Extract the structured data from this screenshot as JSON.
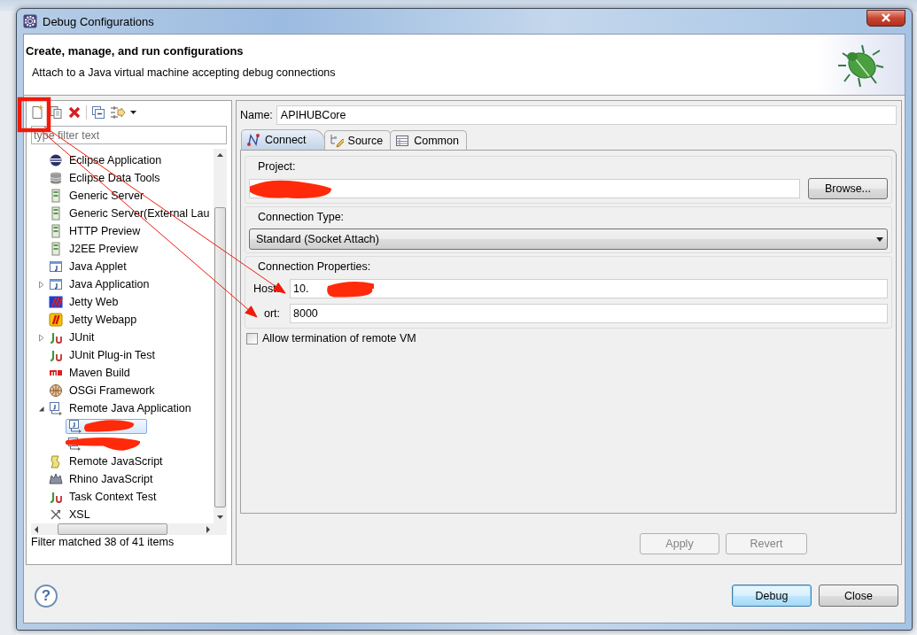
{
  "window": {
    "title": "Debug Configurations"
  },
  "header": {
    "title": "Create, manage, and run configurations",
    "message": "Attach to a Java virtual machine accepting debug connections"
  },
  "filter": {
    "placeholder": "type filter text"
  },
  "tree": [
    {
      "label": "Eclipse Application"
    },
    {
      "label": "Eclipse Data Tools"
    },
    {
      "label": "Generic Server"
    },
    {
      "label": "Generic Server(External Lau"
    },
    {
      "label": "HTTP Preview"
    },
    {
      "label": "J2EE Preview"
    },
    {
      "label": "Java Applet"
    },
    {
      "label": "Java Application",
      "expanded": false
    },
    {
      "label": "Jetty Web"
    },
    {
      "label": "Jetty Webapp"
    },
    {
      "label": "JUnit",
      "expanded": false
    },
    {
      "label": "JUnit Plug-in Test"
    },
    {
      "label": "Maven Build"
    },
    {
      "label": "OSGi Framework"
    },
    {
      "label": "Remote Java Application",
      "expanded": true,
      "children": [
        {
          "selected": true
        },
        {
          "selected": false
        }
      ]
    },
    {
      "label": "Remote JavaScript"
    },
    {
      "label": "Rhino JavaScript"
    },
    {
      "label": "Task Context Test"
    },
    {
      "label": "XSL"
    }
  ],
  "filter_status": "Filter matched 38 of 41 items",
  "name": {
    "label": "Name:",
    "value": "APIHUBCore"
  },
  "tabs": [
    {
      "label": "Connect",
      "selected": true
    },
    {
      "label": "Source",
      "selected": false
    },
    {
      "label": "Common",
      "selected": false
    }
  ],
  "project": {
    "label": "Project:",
    "browse": "Browse..."
  },
  "connection_type": {
    "label": "Connection Type:",
    "value": "Standard (Socket Attach)"
  },
  "connection_properties": {
    "label": "Connection Properties:",
    "host_label": "Host:",
    "host": "10.",
    "port_label": "ort:",
    "port": "8000"
  },
  "allow_termination": {
    "label": "Allow termination of remote VM",
    "checked": false
  },
  "apply": {
    "label": "Apply",
    "disabled": true
  },
  "revert": {
    "label": "Revert",
    "disabled": true
  },
  "buttons": [
    {
      "label": "Debug",
      "default": true
    },
    {
      "label": "Close",
      "default": false
    }
  ],
  "help": "?"
}
